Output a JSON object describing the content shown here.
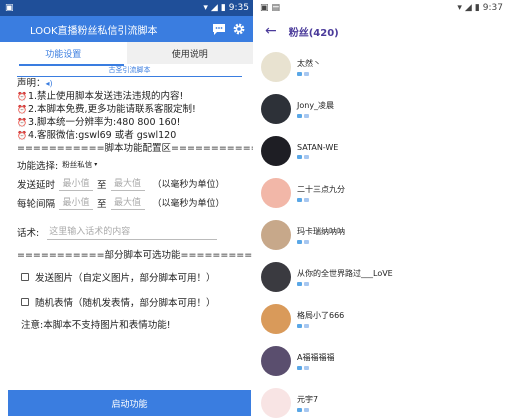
{
  "left": {
    "status_time": "9:35",
    "app_title": "LOOK直播粉丝私信引流脚本",
    "tabs": [
      "功能设置",
      "使用说明"
    ],
    "subtab": "古圣引流脚本",
    "declaration_title": "声明：",
    "notices": [
      "1.禁止使用脚本发送违法违规的内容!",
      "2.本脚本免费,更多功能请联系客服定制!",
      "3.脚本统一分辨率为:480  800  160!",
      "4.客服微信:gswl69 或者 gswl120"
    ],
    "config_divider": "===========脚本功能配置区===========",
    "function_select": {
      "label": "功能选择:",
      "value": "粉丝私信"
    },
    "send_delay": {
      "label": "发送延时",
      "min_placeholder": "最小值",
      "to": "至",
      "max_placeholder": "最大值",
      "hint": "（以毫秒为单位）"
    },
    "round_interval": {
      "label": "每轮间隔",
      "min_placeholder": "最小值",
      "to": "至",
      "max_placeholder": "最大值",
      "hint": "（以毫秒为单位）"
    },
    "talk": {
      "label": "话术:",
      "placeholder": "这里输入话术的内容"
    },
    "partial_divider": "===========部分脚本可选功能===========",
    "options": [
      "发送图片（自定义图片，部分脚本可用！）",
      "随机表情（随机发表情，部分脚本可用！）"
    ],
    "note": "注意:本脚本不支持图片和表情功能!",
    "launch_button": "启动功能"
  },
  "right": {
    "status_time": "9:37",
    "title": "粉丝(420)",
    "fans": [
      {
        "name": "太然丶",
        "color": "#e8e2d0"
      },
      {
        "name": "Jony_凌晨",
        "color": "#2d3138"
      },
      {
        "name": "SATAN-WE",
        "color": "#1e1e24"
      },
      {
        "name": "二十三点九分",
        "color": "#f2b7a8"
      },
      {
        "name": "玛卡瑞纳呐呐",
        "color": "#c7a88a"
      },
      {
        "name": "从你的全世界路过___LoVE",
        "color": "#3a3a40"
      },
      {
        "name": "格局小了666",
        "color": "#d99a5a"
      },
      {
        "name": "A福福福福",
        "color": "#5a4e6e"
      },
      {
        "name": "元宇7",
        "color": "#f8e4e4"
      }
    ],
    "badge_colors": [
      "#5aa7e6",
      "#a7c7f0"
    ]
  }
}
